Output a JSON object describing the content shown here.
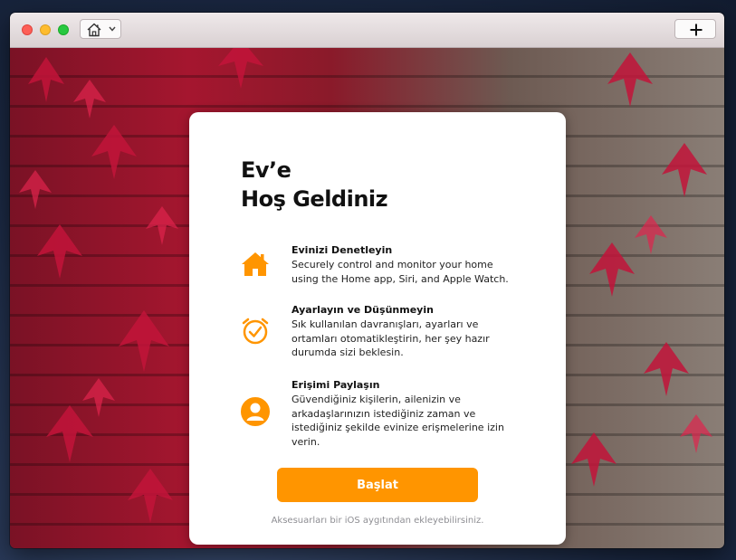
{
  "window": {
    "toolbar": {
      "home_icon": "house-icon",
      "dropdown_icon": "chevron-down-icon",
      "add_icon": "plus-icon"
    }
  },
  "welcome": {
    "title_line1": "Ev’e",
    "title_line2": "Hoş Geldiniz",
    "features": [
      {
        "icon": "house-icon",
        "title": "Evinizi Denetleyin",
        "description": "Securely control and monitor your home using the Home app, Siri, and Apple Watch."
      },
      {
        "icon": "alarm-clock-icon",
        "title": "Ayarlayın ve Düşünmeyin",
        "description": "Sık kullanılan davranışları, ayarları ve ortamları otomatikleştirin, her şey hazır durumda sizi beklesin."
      },
      {
        "icon": "person-icon",
        "title": "Erişimi Paylaşın",
        "description": "Güvendiğiniz kişilerin, ailenizin ve arkadaşlarınızın istediğiniz zaman ve istediğiniz şekilde evinize erişmelerine izin verin."
      }
    ],
    "start_label": "Başlat",
    "footnote": "Aksesuarları bir iOS aygıtından ekleyebilirsiniz."
  },
  "colors": {
    "accent": "#ff9500",
    "title_text": "#111111",
    "footnote_text": "#8e8e93"
  }
}
